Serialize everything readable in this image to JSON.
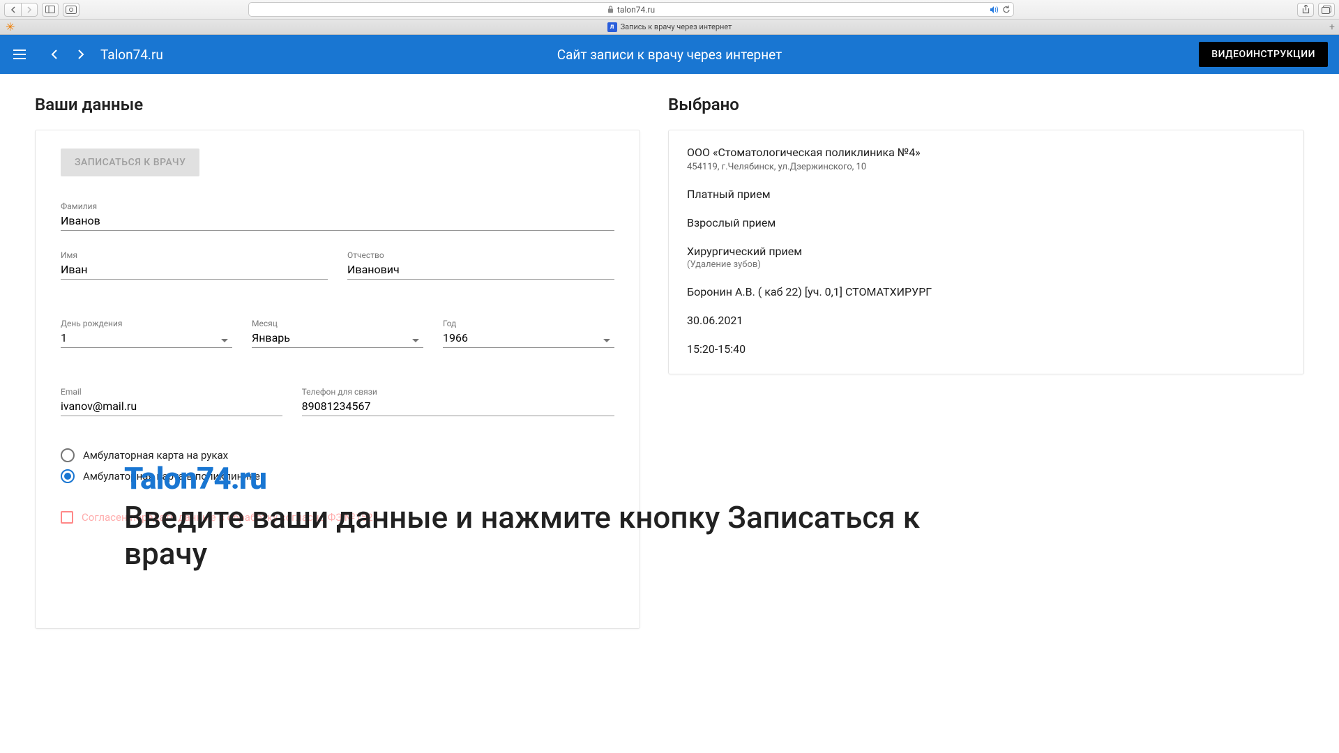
{
  "browser": {
    "url_display": "talon74.ru",
    "tab_title": "Запись к врачу через интернет"
  },
  "header": {
    "brand": "Talon74.ru",
    "subtitle": "Сайт записи к врачу через интернет",
    "video_btn": "ВИДЕОИНСТРУКЦИИ"
  },
  "form": {
    "section_title": "Ваши данные",
    "submit_label": "ЗАПИСАТЬСЯ К ВРАЧУ",
    "surname_label": "Фамилия",
    "surname": "Иванов",
    "name_label": "Имя",
    "name": "Иван",
    "patronymic_label": "Отчество",
    "patronymic": "Иванович",
    "bday_label": "День рождения",
    "bday": "1",
    "bmonth_label": "Месяц",
    "bmonth": "Январь",
    "byear_label": "Год",
    "byear": "1966",
    "email_label": "Email",
    "email": "ivanov@mail.ru",
    "phone_label": "Телефон для связи",
    "phone": "89081234567",
    "radio_hand": "Амбулаторная карта на руках",
    "radio_clinic": "Амбулаторная карта в поликлинике",
    "consent_label": "Согласен передать данные в обработку согласно ФЗ №152"
  },
  "selection": {
    "section_title": "Выбрано",
    "clinic": "ООО  «Стоматологическая поликлиника №4»",
    "address": "454119, г.Челябинск, ул.Дзержинского, 10",
    "pay_type": "Платный прием",
    "age_type": "Взрослый прием",
    "service": "Хирургический прием",
    "service_sub": "(Удаление зубов)",
    "doctor": "Боронин А.В. ( каб 22) [уч. 0,1] СТОМАТХИРУРГ",
    "date": "30.06.2021",
    "time": "15:20-15:40"
  },
  "overlay": {
    "logo": "Talon74.ru",
    "hint": "Введите ваши данные и нажмите кнопку Записаться к врачу"
  }
}
